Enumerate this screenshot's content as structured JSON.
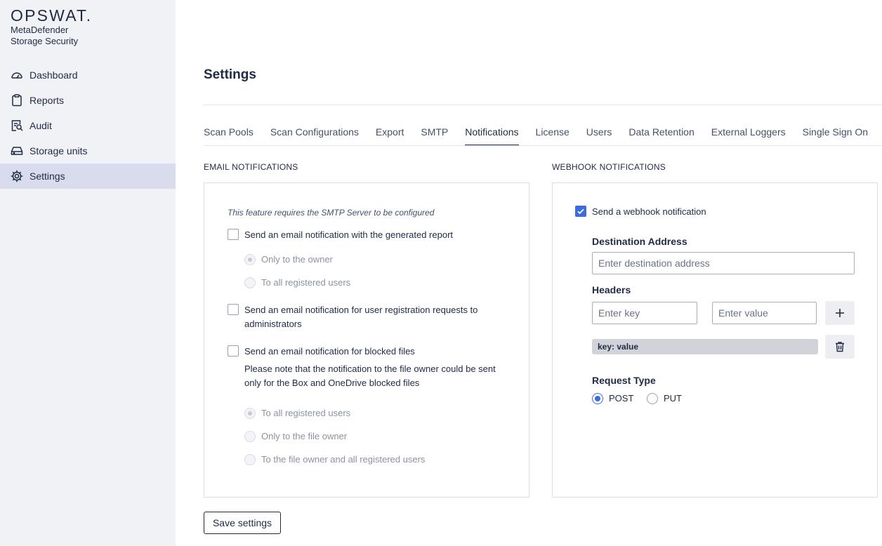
{
  "brand": {
    "logo": "OPSWAT.",
    "product_line1": "MetaDefender",
    "product_line2": "Storage Security"
  },
  "sidebar": {
    "items": [
      {
        "label": "Dashboard",
        "icon": "gauge-icon",
        "active": false
      },
      {
        "label": "Reports",
        "icon": "clipboard-icon",
        "active": false
      },
      {
        "label": "Audit",
        "icon": "audit-icon",
        "active": false
      },
      {
        "label": "Storage units",
        "icon": "drive-icon",
        "active": false
      },
      {
        "label": "Settings",
        "icon": "gear-icon",
        "active": true
      }
    ]
  },
  "page": {
    "title": "Settings"
  },
  "tabs": [
    {
      "label": "Scan Pools",
      "active": false
    },
    {
      "label": "Scan Configurations",
      "active": false
    },
    {
      "label": "Export",
      "active": false
    },
    {
      "label": "SMTP",
      "active": false
    },
    {
      "label": "Notifications",
      "active": true
    },
    {
      "label": "License",
      "active": false
    },
    {
      "label": "Users",
      "active": false
    },
    {
      "label": "Data Retention",
      "active": false
    },
    {
      "label": "External Loggers",
      "active": false
    },
    {
      "label": "Single Sign On",
      "active": false
    }
  ],
  "email": {
    "section_title": "EMAIL NOTIFICATIONS",
    "note": "This feature requires the SMTP Server to be configured",
    "report": {
      "label": "Send an email notification with the generated report",
      "checked": false,
      "options": [
        "Only to the owner",
        "To all registered users"
      ],
      "selected": "Only to the owner"
    },
    "registration": {
      "label_line1": "Send an email notification for user registration requests to",
      "label_line2": "administrators",
      "checked": false
    },
    "blocked": {
      "label": "Send an email notification for blocked files",
      "checked": false,
      "hint_line1": "Please note that the notification to the file owner could be sent",
      "hint_line2": "only for the Box and OneDrive blocked files",
      "options": [
        "To all registered users",
        "Only to the file owner",
        "To the file owner and all registered users"
      ],
      "selected": "To all registered users"
    }
  },
  "webhook": {
    "section_title": "WEBHOOK NOTIFICATIONS",
    "enable_label": "Send a webhook notification",
    "enabled": true,
    "destination_label": "Destination Address",
    "destination_placeholder": "Enter destination address",
    "headers_label": "Headers",
    "key_placeholder": "Enter key",
    "value_placeholder": "Enter value",
    "header_tag": "key: value",
    "request_type_label": "Request Type",
    "methods": [
      "POST",
      "PUT"
    ],
    "selected_method": "POST"
  },
  "actions": {
    "save_label": "Save settings"
  },
  "colors": {
    "accent": "#3d6ce0",
    "sidebar_bg": "#f1f2f6",
    "active_nav": "#d9dcec",
    "text": "#1f2a44"
  }
}
